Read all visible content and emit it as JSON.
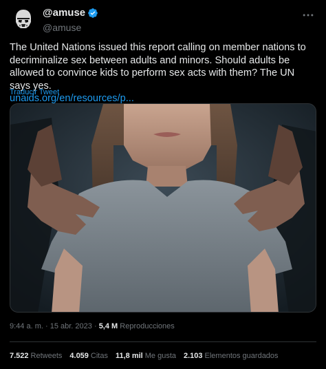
{
  "author": {
    "display_name": "@amuse",
    "handle": "@amuse",
    "verified": true,
    "avatar_icon": "stormtrooper-helmet-icon"
  },
  "tweet": {
    "text": "The United Nations issued this report calling on member nations to decriminalize sex between adults and minors. Should adults be allowed to convince kids to perform sex acts with them? The UN says yes.",
    "link_text": "unaids.org/en/resources/p...",
    "translate_label": "Traducir Tweet"
  },
  "meta": {
    "time": "9:44 a. m.",
    "separator": "·",
    "date": "15 abr. 2023",
    "views_count": "5,4 M",
    "views_label": "Reproducciones"
  },
  "stats": {
    "retweets_count": "7.522",
    "retweets_label": "Retweets",
    "quotes_count": "4.059",
    "quotes_label": "Citas",
    "likes_count": "11,8 mil",
    "likes_label": "Me gusta",
    "bookmarks_count": "2.103",
    "bookmarks_label": "Elementos guardados"
  },
  "colors": {
    "background": "#000000",
    "text": "#e7e9ea",
    "secondary": "#71767b",
    "link": "#1d9bf0",
    "divider": "#2f3336"
  }
}
